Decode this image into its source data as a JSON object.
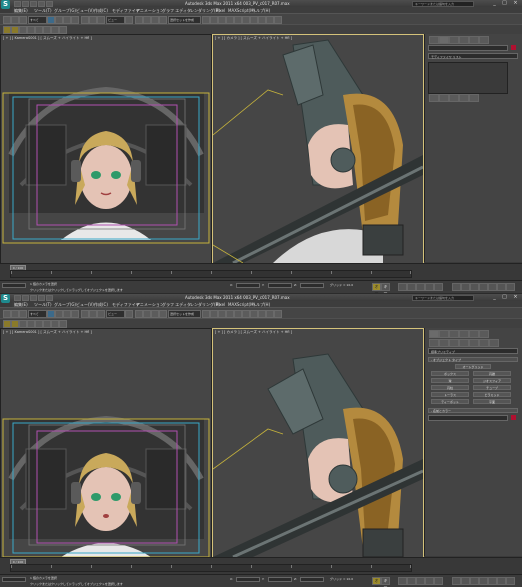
{
  "app": {
    "logo": "S",
    "title": "Autodesk 3ds Max 2011 x64     003_PV_c017_R07.max",
    "search_placeholder": "キーワードまたは語句を入力",
    "window_controls": [
      "_",
      "□",
      "×"
    ]
  },
  "menu": {
    "items": [
      "編集(E)",
      "ツール(T)",
      "グループ(G)",
      "ビュー(V)",
      "作成(C)",
      "モディファイヤ",
      "アニメーション",
      "グラフ エディタ",
      "レンダリング(R)",
      "Pixel",
      "MAXScript(M)",
      "ヘルプ(H)"
    ]
  },
  "toolbar": {
    "selection_filter": "すべて",
    "view_dropdown": "ビュー",
    "named_selection": "選択セットを作成"
  },
  "viewports": {
    "left_label": "[ + ] [ KameraS001 ] [ スムーズ + ハイライト + Hfl ]",
    "right_label": "[ + ] [ カメラ ] [ スムーズ + ハイライト + Hfl ]"
  },
  "command_panel": {
    "top": {
      "name_field": "",
      "list_title": "モディファイヤ リスト",
      "color": "#b01030"
    },
    "bottom": {
      "section_title": "標準プリミティブ",
      "rollout_object_type": "- オブジェクト タイプ",
      "autogrid": "オートグリッド",
      "buttons": [
        "ボックス",
        "円錐",
        "球",
        "ジオスフィア",
        "円柱",
        "チューブ",
        "トーラス",
        "ピラミッド",
        "ティーポット",
        "平面"
      ],
      "rollout_name_color": "- 名前とカラー",
      "color": "#b01030"
    }
  },
  "timeline": {
    "slider": "0 / 100",
    "ticks": [
      "0",
      "10",
      "20",
      "30",
      "40",
      "50",
      "60",
      "70",
      "80",
      "90",
      "100"
    ]
  },
  "status": {
    "line1": "1 個のカメラを選択",
    "line2": "クリックまたはクリックしてドラッグしてオブジェクトを選択します",
    "x_label": "X:",
    "y_label": "Y:",
    "z_label": "Z:",
    "grid": "グリッド = 10.0",
    "autokey": "オートキー",
    "setkey": "キー設定",
    "selected": "選択",
    "key_filter": "キー フィルタ..."
  }
}
